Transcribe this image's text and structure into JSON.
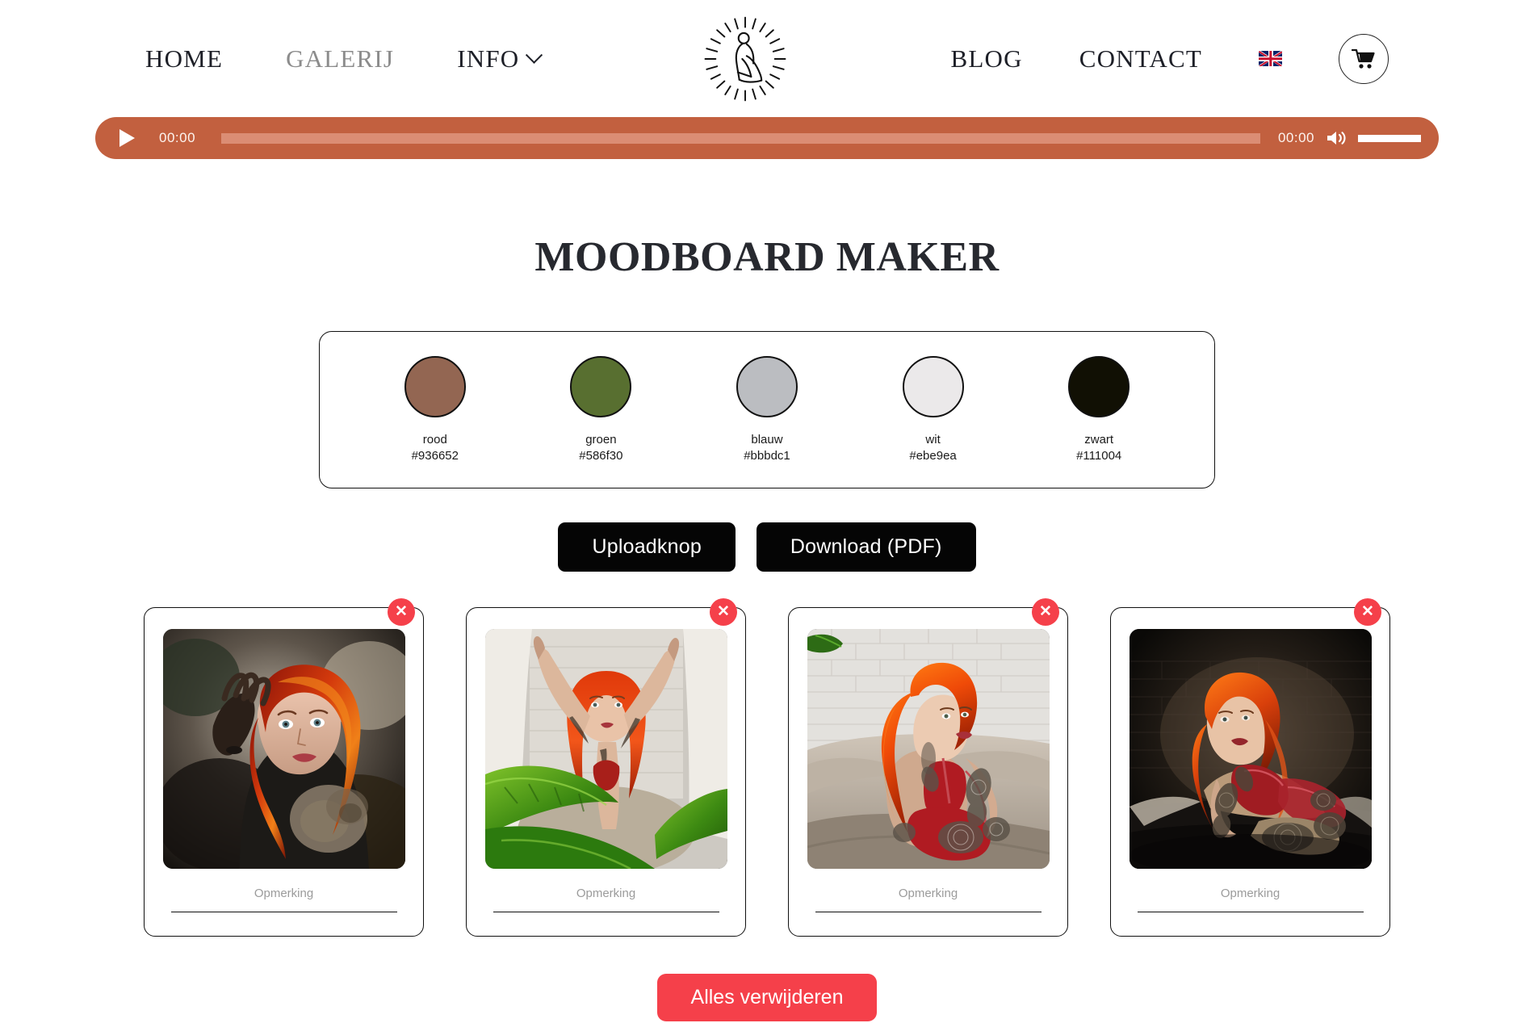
{
  "nav": {
    "left_items": [
      {
        "label": "HOME",
        "muted": false,
        "has_chevron": false
      },
      {
        "label": "GALERIJ",
        "muted": true,
        "has_chevron": false
      },
      {
        "label": "INFO",
        "muted": false,
        "has_chevron": true
      }
    ],
    "right_items": [
      {
        "label": "BLOG",
        "muted": false,
        "has_chevron": false
      },
      {
        "label": "CONTACT",
        "muted": false,
        "has_chevron": false
      }
    ],
    "logo_icon": "seated-figure-sunburst-logo",
    "flag_icon": "uk-flag-icon",
    "cart_icon": "shopping-cart-icon",
    "chevron_icon": "chevron-down-icon"
  },
  "player": {
    "play_icon": "play-icon",
    "current_time": "00:00",
    "duration": "00:00",
    "volume_icon": "speaker-volume-icon",
    "progress_percent": 0,
    "volume_percent": 100,
    "bar_color": "#c2603f",
    "track_color": "#db8d74"
  },
  "main": {
    "title": "MOODBOARD MAKER",
    "palette": [
      {
        "name": "rood",
        "hex": "#936652"
      },
      {
        "name": "groen",
        "hex": "#586f30"
      },
      {
        "name": "blauw",
        "hex": "#bbbdc1"
      },
      {
        "name": "wit",
        "hex": "#ebe9ea"
      },
      {
        "name": "zwart",
        "hex": "#111004"
      }
    ],
    "actions": {
      "upload_label": "Uploadknop",
      "download_label": "Download (PDF)"
    },
    "cards": [
      {
        "image_alt": "portrait-red-haired-tattooed-woman-hand-raised",
        "note_label": "Opmerking",
        "note_value": "",
        "delete_icon": "close-icon"
      },
      {
        "image_alt": "red-haired-woman-arms-raised-behind-green-foliage",
        "note_label": "Opmerking",
        "note_value": "",
        "delete_icon": "close-icon"
      },
      {
        "image_alt": "red-haired-woman-red-lingerie-on-bed-brick-wall",
        "note_label": "Opmerking",
        "note_value": "",
        "delete_icon": "close-icon"
      },
      {
        "image_alt": "red-haired-woman-reclining-red-lingerie-dark-room",
        "note_label": "Opmerking",
        "note_value": "",
        "delete_icon": "close-icon"
      }
    ],
    "clear_all_label": "Alles verwijderen"
  },
  "colors": {
    "accent_terracotta": "#c2603f",
    "accent_red": "#f5404a",
    "button_black": "#050505",
    "text_dark": "#1d1f27",
    "text_muted": "#8c8c8c"
  }
}
